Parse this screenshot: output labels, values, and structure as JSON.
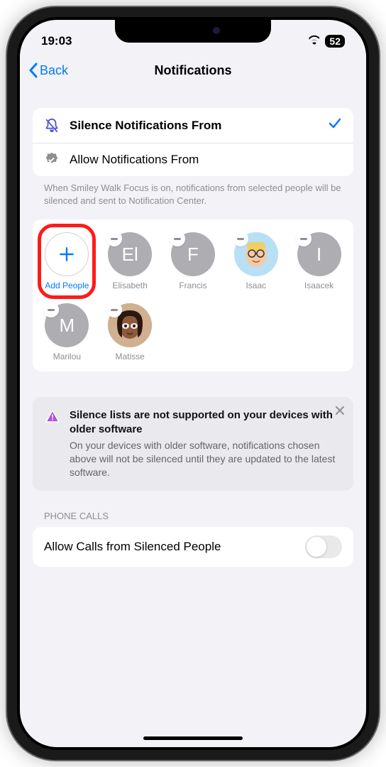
{
  "status": {
    "time": "19:03",
    "battery": "52"
  },
  "nav": {
    "back": "Back",
    "title": "Notifications"
  },
  "options": {
    "silence": "Silence Notifications From",
    "allow": "Allow Notifications From",
    "help": "When Smiley Walk Focus is on, notifications from selected people will be silenced and sent to Notification Center."
  },
  "people": {
    "add": "Add People",
    "items": [
      {
        "name": "Elisabeth",
        "initials": "El"
      },
      {
        "name": "Francis",
        "initials": "F"
      },
      {
        "name": "Isaac",
        "initials": ""
      },
      {
        "name": "Isaacek",
        "initials": "I"
      },
      {
        "name": "Marilou",
        "initials": "M"
      },
      {
        "name": "Matisse",
        "initials": ""
      }
    ]
  },
  "warning": {
    "title": "Silence lists are not supported on your devices with older software",
    "body": "On your devices with older software, notifications chosen above will not be silenced until they are updated to the latest software."
  },
  "calls": {
    "header": "PHONE CALLS",
    "label": "Allow Calls from Silenced People"
  }
}
